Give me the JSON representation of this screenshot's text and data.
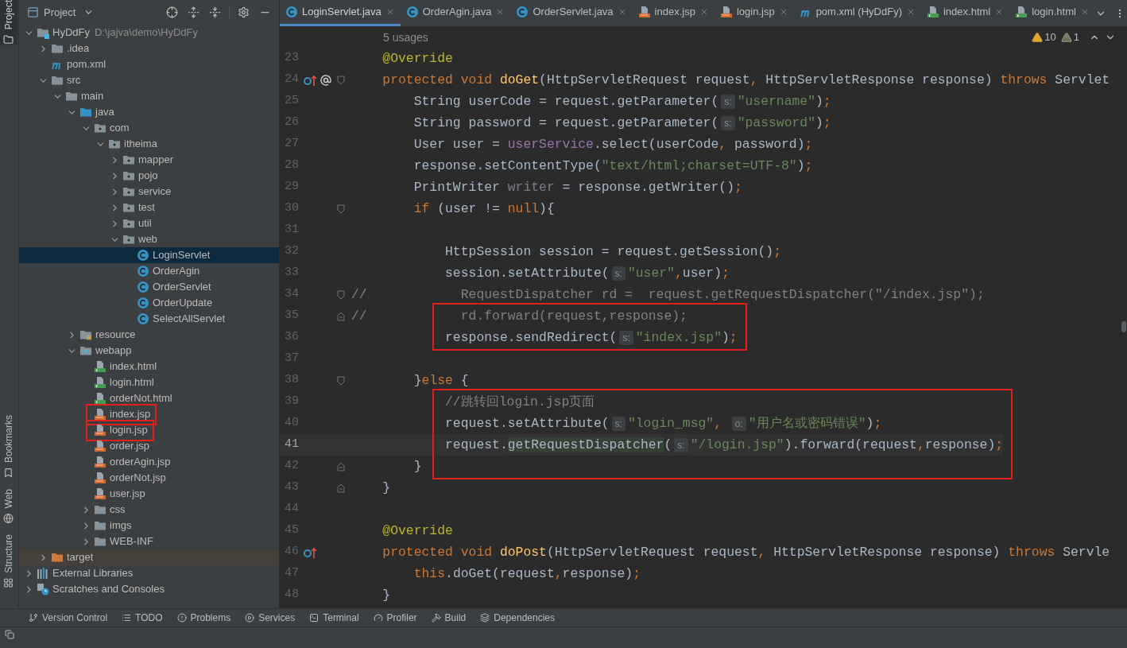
{
  "side_strip": [
    {
      "label": "Project",
      "kind": "project",
      "selected": true
    },
    {
      "label": "Bookmarks",
      "kind": "bookmarks",
      "selected": false
    },
    {
      "label": "Web",
      "kind": "web",
      "selected": false
    },
    {
      "label": "Structure",
      "kind": "structure",
      "selected": false
    }
  ],
  "project_panel": {
    "title": "Project",
    "tree": [
      {
        "label": "HyDdFy",
        "kind": "module",
        "path": "D:\\jajva\\demo\\HyDdFy",
        "expanded": true,
        "selected": false,
        "boxed": false,
        "children": [
          {
            "label": ".idea",
            "kind": "folder",
            "expanded": false,
            "selected": false,
            "boxed": false
          },
          {
            "label": "pom.xml",
            "kind": "maven",
            "selected": false,
            "boxed": false
          },
          {
            "label": "src",
            "kind": "folder",
            "expanded": true,
            "selected": false,
            "boxed": false,
            "children": [
              {
                "label": "main",
                "kind": "folder",
                "expanded": true,
                "selected": false,
                "boxed": false,
                "children": [
                  {
                    "label": "java",
                    "kind": "source-folder",
                    "expanded": true,
                    "selected": false,
                    "boxed": false,
                    "children": [
                      {
                        "label": "com",
                        "kind": "package",
                        "expanded": true,
                        "selected": false,
                        "boxed": false,
                        "children": [
                          {
                            "label": "itheima",
                            "kind": "package",
                            "expanded": true,
                            "selected": false,
                            "boxed": false,
                            "children": [
                              {
                                "label": "mapper",
                                "kind": "package",
                                "expanded": false,
                                "selected": false,
                                "boxed": false
                              },
                              {
                                "label": "pojo",
                                "kind": "package",
                                "expanded": false,
                                "selected": false,
                                "boxed": false
                              },
                              {
                                "label": "service",
                                "kind": "package",
                                "expanded": false,
                                "selected": false,
                                "boxed": false
                              },
                              {
                                "label": "test",
                                "kind": "package",
                                "expanded": false,
                                "selected": false,
                                "boxed": false
                              },
                              {
                                "label": "util",
                                "kind": "package",
                                "expanded": false,
                                "selected": false,
                                "boxed": false
                              },
                              {
                                "label": "web",
                                "kind": "package",
                                "expanded": true,
                                "selected": false,
                                "boxed": false,
                                "children": [
                                  {
                                    "label": "LoginServlet",
                                    "kind": "class",
                                    "selected": true,
                                    "boxed": false
                                  },
                                  {
                                    "label": "OrderAgin",
                                    "kind": "class",
                                    "selected": false,
                                    "boxed": false
                                  },
                                  {
                                    "label": "OrderServlet",
                                    "kind": "class",
                                    "selected": false,
                                    "boxed": false
                                  },
                                  {
                                    "label": "OrderUpdate",
                                    "kind": "class",
                                    "selected": false,
                                    "boxed": false
                                  },
                                  {
                                    "label": "SelectAllServlet",
                                    "kind": "class",
                                    "selected": false,
                                    "boxed": false
                                  }
                                ]
                              }
                            ]
                          }
                        ]
                      }
                    ]
                  },
                  {
                    "label": "resource",
                    "kind": "resource-folder",
                    "expanded": false,
                    "selected": false,
                    "boxed": false
                  },
                  {
                    "label": "webapp",
                    "kind": "web-folder",
                    "expanded": true,
                    "selected": false,
                    "boxed": false,
                    "children": [
                      {
                        "label": "index.html",
                        "kind": "html",
                        "selected": false,
                        "boxed": false
                      },
                      {
                        "label": "login.html",
                        "kind": "html",
                        "selected": false,
                        "boxed": false
                      },
                      {
                        "label": "orderNot.html",
                        "kind": "html",
                        "selected": false,
                        "boxed": false
                      },
                      {
                        "label": "index.jsp",
                        "kind": "jsp",
                        "selected": false,
                        "boxed": true
                      },
                      {
                        "label": "login.jsp",
                        "kind": "jsp",
                        "selected": false,
                        "boxed": true
                      },
                      {
                        "label": "order.jsp",
                        "kind": "jsp",
                        "selected": false,
                        "boxed": false
                      },
                      {
                        "label": "orderAgin.jsp",
                        "kind": "jsp",
                        "selected": false,
                        "boxed": false
                      },
                      {
                        "label": "orderNot.jsp",
                        "kind": "jsp",
                        "selected": false,
                        "boxed": false
                      },
                      {
                        "label": "user.jsp",
                        "kind": "jsp",
                        "selected": false,
                        "boxed": false
                      },
                      {
                        "label": "css",
                        "kind": "folder",
                        "expanded": false,
                        "selected": false,
                        "boxed": false
                      },
                      {
                        "label": "imgs",
                        "kind": "folder",
                        "expanded": false,
                        "selected": false,
                        "boxed": false
                      },
                      {
                        "label": "WEB-INF",
                        "kind": "folder",
                        "expanded": false,
                        "selected": false,
                        "boxed": false
                      }
                    ]
                  }
                ]
              }
            ]
          },
          {
            "label": "target",
            "kind": "excluded-folder",
            "expanded": false,
            "selected": false,
            "boxed": false
          }
        ]
      },
      {
        "label": "External Libraries",
        "kind": "libraries",
        "expanded": false,
        "selected": false,
        "boxed": false
      },
      {
        "label": "Scratches and Consoles",
        "kind": "scratches",
        "expanded": false,
        "selected": false,
        "boxed": false
      }
    ]
  },
  "editor": {
    "tabs": [
      {
        "label": "LoginServlet.java",
        "kind": "class",
        "selected": true
      },
      {
        "label": "OrderAgin.java",
        "kind": "class",
        "selected": false
      },
      {
        "label": "OrderServlet.java",
        "kind": "class",
        "selected": false
      },
      {
        "label": "index.jsp",
        "kind": "jsp",
        "selected": false
      },
      {
        "label": "login.jsp",
        "kind": "jsp",
        "selected": false
      },
      {
        "label": "pom.xml (HyDdFy)",
        "kind": "maven",
        "selected": false
      },
      {
        "label": "index.html",
        "kind": "html",
        "selected": false
      },
      {
        "label": "login.html",
        "kind": "html",
        "selected": false
      }
    ],
    "usages": "5 usages",
    "inspections": [
      {
        "kind": "warning",
        "count": "10"
      },
      {
        "kind": "weak-warning",
        "count": "1"
      }
    ],
    "lines": [
      {
        "number": "23",
        "current": false,
        "boxed": false,
        "tokens": [
          {
            "kind": "ann",
            "text": "    @Override"
          }
        ]
      },
      {
        "number": "24",
        "current": false,
        "boxed": false,
        "gutter_icons": [
          {
            "kind": "override"
          },
          {
            "kind": "annotation"
          }
        ],
        "fold": {
          "kind": "open"
        },
        "tokens": [
          {
            "kind": "kw",
            "text": "    protected void "
          },
          {
            "kind": "decl",
            "text": "doGet"
          },
          {
            "kind": "plain",
            "text": "(HttpServletRequest request"
          },
          {
            "kind": "punct",
            "text": ", "
          },
          {
            "kind": "plain",
            "text": "HttpServletResponse response) "
          },
          {
            "kind": "kw",
            "text": "throws "
          },
          {
            "kind": "plain",
            "text": "Servlet"
          }
        ]
      },
      {
        "number": "25",
        "current": false,
        "boxed": false,
        "tokens": [
          {
            "kind": "plain",
            "text": "        String userCode = request.getParameter("
          },
          {
            "kind": "hint",
            "text": "s:"
          },
          {
            "kind": "str",
            "text": "\"username\""
          },
          {
            "kind": "plain",
            "text": ")"
          },
          {
            "kind": "punct",
            "text": ";"
          }
        ]
      },
      {
        "number": "26",
        "current": false,
        "boxed": false,
        "tokens": [
          {
            "kind": "plain",
            "text": "        String password = request.getParameter("
          },
          {
            "kind": "hint",
            "text": "s:"
          },
          {
            "kind": "str",
            "text": "\"password\""
          },
          {
            "kind": "plain",
            "text": ")"
          },
          {
            "kind": "punct",
            "text": ";"
          }
        ]
      },
      {
        "number": "27",
        "current": false,
        "boxed": false,
        "tokens": [
          {
            "kind": "plain",
            "text": "        User user = "
          },
          {
            "kind": "field",
            "text": "userService"
          },
          {
            "kind": "plain",
            "text": ".select(userCode"
          },
          {
            "kind": "punct",
            "text": ", "
          },
          {
            "kind": "plain",
            "text": "password)"
          },
          {
            "kind": "punct",
            "text": ";"
          }
        ]
      },
      {
        "number": "28",
        "current": false,
        "boxed": false,
        "tokens": [
          {
            "kind": "plain",
            "text": "        response.setContentType("
          },
          {
            "kind": "str",
            "text": "\"text/html;charset=UTF-8\""
          },
          {
            "kind": "plain",
            "text": ")"
          },
          {
            "kind": "punct",
            "text": ";"
          }
        ]
      },
      {
        "number": "29",
        "current": false,
        "boxed": false,
        "tokens": [
          {
            "kind": "plain",
            "text": "        PrintWriter "
          },
          {
            "kind": "unused",
            "text": "writer"
          },
          {
            "kind": "plain",
            "text": " = response.getWriter()"
          },
          {
            "kind": "punct",
            "text": ";"
          }
        ]
      },
      {
        "number": "30",
        "current": false,
        "boxed": false,
        "fold": {
          "kind": "open"
        },
        "tokens": [
          {
            "kind": "kw",
            "text": "        if "
          },
          {
            "kind": "plain",
            "text": "(user != "
          },
          {
            "kind": "kw",
            "text": "null"
          },
          {
            "kind": "plain",
            "text": "){"
          }
        ]
      },
      {
        "number": "31",
        "current": false,
        "boxed": false
      },
      {
        "number": "32",
        "current": false,
        "boxed": false,
        "tokens": [
          {
            "kind": "plain",
            "text": "            HttpSession session = request.getSession()"
          },
          {
            "kind": "punct",
            "text": ";"
          }
        ]
      },
      {
        "number": "33",
        "current": false,
        "boxed": false,
        "tokens": [
          {
            "kind": "plain",
            "text": "            session.setAttribute("
          },
          {
            "kind": "hint",
            "text": "s:"
          },
          {
            "kind": "str",
            "text": "\"user\""
          },
          {
            "kind": "punct",
            "text": ","
          },
          {
            "kind": "plain",
            "text": "user)"
          },
          {
            "kind": "punct",
            "text": ";"
          }
        ]
      },
      {
        "number": "34",
        "current": false,
        "boxed": false,
        "fold": {
          "kind": "open"
        },
        "tokens": [
          {
            "kind": "comment",
            "text": "//            RequestDispatcher rd =  request.getRequestDispatcher(\"/index.jsp\");"
          }
        ]
      },
      {
        "number": "35",
        "current": false,
        "boxed": true,
        "fold": {
          "kind": "close"
        },
        "tokens": [
          {
            "kind": "comment",
            "text": "//            rd.forward(request,response);"
          }
        ]
      },
      {
        "number": "36",
        "current": false,
        "boxed": true,
        "tokens": [
          {
            "kind": "plain",
            "text": "            response.sendRedirect("
          },
          {
            "kind": "hint",
            "text": "s:"
          },
          {
            "kind": "str",
            "text": "\"index.jsp\""
          },
          {
            "kind": "plain",
            "text": ")"
          },
          {
            "kind": "punct",
            "text": ";"
          }
        ]
      },
      {
        "number": "37",
        "current": false,
        "boxed": false
      },
      {
        "number": "38",
        "current": false,
        "boxed": false,
        "fold": {
          "kind": "open"
        },
        "tokens": [
          {
            "kind": "plain",
            "text": "        }"
          },
          {
            "kind": "kw",
            "text": "else "
          },
          {
            "kind": "plain",
            "text": "{"
          }
        ]
      },
      {
        "number": "39",
        "current": false,
        "boxed": true,
        "tokens": [
          {
            "kind": "comment",
            "text": "            //跳转回login.jsp页面"
          }
        ]
      },
      {
        "number": "40",
        "current": false,
        "boxed": true,
        "tokens": [
          {
            "kind": "plain",
            "text": "            request.setAttribute("
          },
          {
            "kind": "hint",
            "text": "s:"
          },
          {
            "kind": "str",
            "text": "\"login_msg\""
          },
          {
            "kind": "punct",
            "text": ", "
          },
          {
            "kind": "hint",
            "text": "o:"
          },
          {
            "kind": "str",
            "text": "\"用户名或密码错误\""
          },
          {
            "kind": "plain",
            "text": ")"
          },
          {
            "kind": "punct",
            "text": ";"
          }
        ]
      },
      {
        "number": "41",
        "current": true,
        "boxed": true,
        "tokens": [
          {
            "kind": "plain",
            "text": "            request."
          },
          {
            "kind": "deprecated",
            "text": "getRequestDispatcher"
          },
          {
            "kind": "plain",
            "text": "("
          },
          {
            "kind": "hint",
            "text": "s:"
          },
          {
            "kind": "str",
            "text": "\"/login.jsp\""
          },
          {
            "kind": "plain",
            "text": ").forward(request"
          },
          {
            "kind": "punct",
            "text": ","
          },
          {
            "kind": "plain",
            "text": "response)"
          },
          {
            "kind": "punct",
            "text": ";"
          }
        ]
      },
      {
        "number": "42",
        "current": false,
        "boxed": true,
        "fold": {
          "kind": "close"
        },
        "tokens": [
          {
            "kind": "plain",
            "text": "        }"
          }
        ]
      },
      {
        "number": "43",
        "current": false,
        "boxed": false,
        "fold": {
          "kind": "close"
        },
        "tokens": [
          {
            "kind": "plain",
            "text": "    }"
          }
        ]
      },
      {
        "number": "44",
        "current": false,
        "boxed": false
      },
      {
        "number": "45",
        "current": false,
        "boxed": false,
        "tokens": [
          {
            "kind": "ann",
            "text": "    @Override"
          }
        ]
      },
      {
        "number": "46",
        "current": false,
        "boxed": false,
        "gutter_icons": [
          {
            "kind": "override"
          }
        ],
        "tokens": [
          {
            "kind": "kw",
            "text": "    protected void "
          },
          {
            "kind": "decl",
            "text": "doPost"
          },
          {
            "kind": "plain",
            "text": "(HttpServletRequest request"
          },
          {
            "kind": "punct",
            "text": ", "
          },
          {
            "kind": "plain",
            "text": "HttpServletResponse response) "
          },
          {
            "kind": "kw",
            "text": "throws "
          },
          {
            "kind": "plain",
            "text": "Servle"
          }
        ]
      },
      {
        "number": "47",
        "current": false,
        "boxed": false,
        "tokens": [
          {
            "kind": "kw",
            "text": "        this"
          },
          {
            "kind": "plain",
            "text": ".doGet(request"
          },
          {
            "kind": "punct",
            "text": ","
          },
          {
            "kind": "plain",
            "text": "response)"
          },
          {
            "kind": "punct",
            "text": ";"
          }
        ]
      },
      {
        "number": "48",
        "current": false,
        "boxed": false,
        "tokens": [
          {
            "kind": "plain",
            "text": "    }"
          }
        ]
      }
    ]
  },
  "tool_windows": [
    {
      "label": "Version Control",
      "kind": "vcs"
    },
    {
      "label": "TODO",
      "kind": "todo"
    },
    {
      "label": "Problems",
      "kind": "problems"
    },
    {
      "label": "Services",
      "kind": "services"
    },
    {
      "label": "Terminal",
      "kind": "terminal"
    },
    {
      "label": "Profiler",
      "kind": "profiler"
    },
    {
      "label": "Build",
      "kind": "build"
    },
    {
      "label": "Dependencies",
      "kind": "dependencies"
    }
  ]
}
